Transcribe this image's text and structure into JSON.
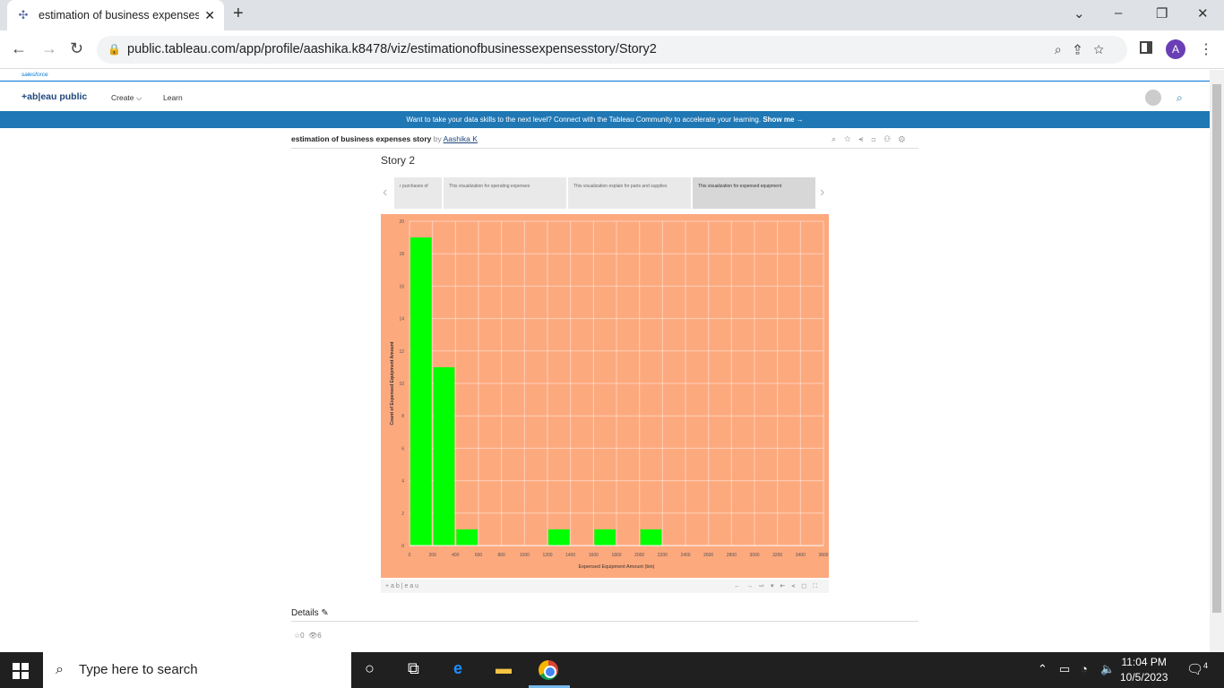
{
  "browser": {
    "tab_title": "estimation of business expenses",
    "url": "public.tableau.com/app/profile/aashika.k8478/viz/estimationofbusinessexpensesstory/Story2",
    "profile_initial": "A"
  },
  "salesforce_label": "salesforce",
  "header": {
    "logo": "+ab|eau public",
    "nav": [
      "Create ⌵",
      "Learn"
    ]
  },
  "banner": {
    "text": "Want to take your data skills to the next level? Connect with the Tableau Community to accelerate your learning.",
    "cta": "Show me →"
  },
  "viz": {
    "title": "estimation of business expenses story",
    "by": "by",
    "author": "Aashika K"
  },
  "story": {
    "title": "Story 2",
    "points": [
      "r purchases of",
      "This visualization for operating expenses",
      "This visualization explain for parts and supplies",
      "This visualization for expensed equipment"
    ],
    "active_index": 3
  },
  "chart_data": {
    "type": "bar",
    "xlabel": "Expensed Equipment Amount (bin)",
    "ylabel": "Count of Expensed Equipment Amount",
    "x_ticks": [
      "0",
      "200",
      "400",
      "600",
      "800",
      "1000",
      "1200",
      "1400",
      "1600",
      "1800",
      "2000",
      "2200",
      "2400",
      "2600",
      "2800",
      "3000",
      "3200",
      "3400",
      "3600"
    ],
    "y_ticks": [
      0,
      2,
      4,
      6,
      8,
      10,
      12,
      14,
      16,
      18,
      20
    ],
    "ylim": [
      0,
      20
    ],
    "bin_width": 200,
    "bins": [
      {
        "x": 0,
        "count": 19
      },
      {
        "x": 200,
        "count": 11
      },
      {
        "x": 400,
        "count": 1
      },
      {
        "x": 1200,
        "count": 1
      },
      {
        "x": 1600,
        "count": 1
      },
      {
        "x": 2000,
        "count": 1
      }
    ],
    "bar_color": "#00ff00",
    "background": "#fda97e"
  },
  "viz_toolbar": {
    "logo": "+ a b | e a u"
  },
  "details": {
    "label": "Details",
    "favorites": "0",
    "views": "6"
  },
  "taskbar": {
    "search_placeholder": "Type here to search",
    "time": "11:04 PM",
    "date": "10/5/2023",
    "notifications": "4"
  }
}
